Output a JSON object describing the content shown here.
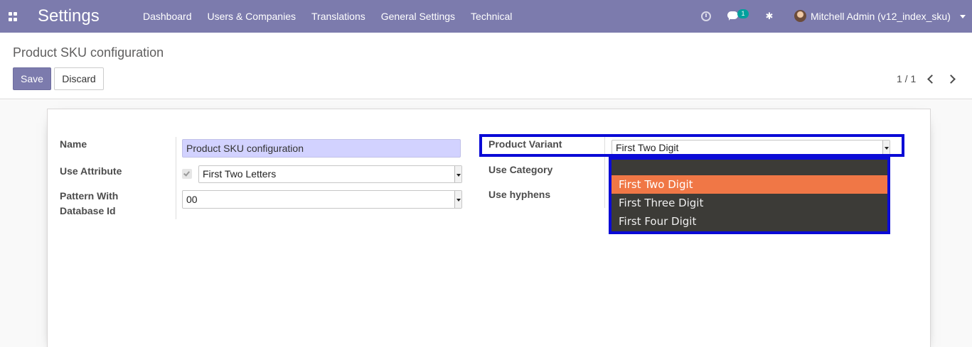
{
  "navbar": {
    "brand": "Settings",
    "menu": [
      "Dashboard",
      "Users & Companies",
      "Translations",
      "General Settings",
      "Technical"
    ],
    "chat_badge": "1",
    "user": "Mitchell Admin (v12_index_sku)"
  },
  "control_panel": {
    "breadcrumb": "Product SKU configuration",
    "save_label": "Save",
    "discard_label": "Discard",
    "pager": "1 / 1"
  },
  "form": {
    "left": {
      "name_label": "Name",
      "name_value": "Product SKU configuration",
      "use_attribute_label": "Use Attribute",
      "use_attribute_checked": true,
      "use_attribute_value": "First Two Letters",
      "pattern_label_line1": "Pattern With",
      "pattern_label_line2": "Database Id",
      "pattern_value": "00"
    },
    "right": {
      "product_variant_label": "Product Variant",
      "product_variant_value": "First Two Digit",
      "use_category_label": "Use Category",
      "use_hyphens_label": "Use hyphens"
    }
  },
  "dropdown": {
    "options": [
      "First Two Digit",
      "First Three Digit",
      "First Four Digit"
    ],
    "selected": "First Two Digit",
    "highlight_color": "#f07746",
    "annotation_color": "#0a0ad6"
  },
  "colors": {
    "navbar": "#7c7bad",
    "primary": "#7c7bad",
    "required_field": "#d2d2ff"
  }
}
